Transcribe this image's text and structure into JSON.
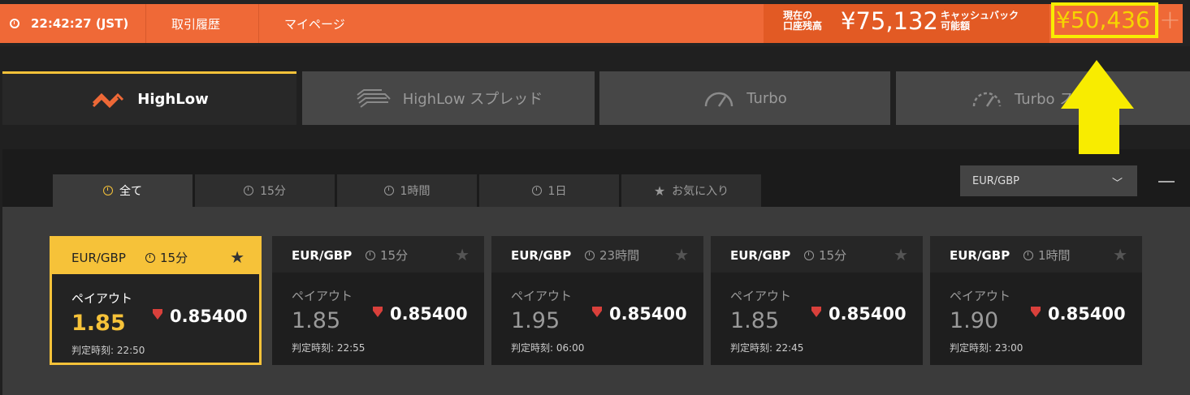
{
  "topbar": {
    "time": "22:42:27 (JST)",
    "nav": [
      "取引履歴",
      "マイページ"
    ],
    "balance_label_1": "現在の",
    "balance_label_2": "口座残高",
    "balance_value": "¥75,132",
    "cashback_label_1": "キャッシュバック",
    "cashback_label_2": "可能額",
    "cashback_value": "¥50,436",
    "plus_icon": "+"
  },
  "product_tabs": [
    {
      "label": "HighLow",
      "icon": "highlow-icon",
      "active": true
    },
    {
      "label": "HighLow スプレッド",
      "icon": "highlow-spread-icon",
      "active": false
    },
    {
      "label": "Turbo",
      "icon": "speedometer-icon",
      "active": false
    },
    {
      "label": "Turbo ス",
      "icon": "speedometer-icon",
      "active": false
    }
  ],
  "filter_tabs": [
    {
      "label": "全て",
      "icon": "clock-icon",
      "active": true
    },
    {
      "label": "15分",
      "icon": "clock-icon",
      "active": false
    },
    {
      "label": "1時間",
      "icon": "clock-icon",
      "active": false
    },
    {
      "label": "1日",
      "icon": "clock-icon",
      "active": false
    },
    {
      "label": "お気に入り",
      "icon": "star-icon",
      "active": false
    }
  ],
  "asset_select": {
    "value": "EUR/GBP",
    "chevron": "﹀"
  },
  "cards": [
    {
      "pair": "EUR/GBP",
      "duration": "15分",
      "payout_label": "ペイアウト",
      "payout": "1.85",
      "rate": "0.85400",
      "expiry": "判定時刻: 22:50",
      "active": true
    },
    {
      "pair": "EUR/GBP",
      "duration": "15分",
      "payout_label": "ペイアウト",
      "payout": "1.85",
      "rate": "0.85400",
      "expiry": "判定時刻: 22:55",
      "active": false
    },
    {
      "pair": "EUR/GBP",
      "duration": "23時間",
      "payout_label": "ペイアウト",
      "payout": "1.95",
      "rate": "0.85400",
      "expiry": "判定時刻: 06:00",
      "active": false
    },
    {
      "pair": "EUR/GBP",
      "duration": "15分",
      "payout_label": "ペイアウト",
      "payout": "1.85",
      "rate": "0.85400",
      "expiry": "判定時刻: 22:45",
      "active": false
    },
    {
      "pair": "EUR/GBP",
      "duration": "1時間",
      "payout_label": "ペイアウト",
      "payout": "1.90",
      "rate": "0.85400",
      "expiry": "判定時刻: 23:00",
      "active": false
    }
  ],
  "colors": {
    "accent_orange": "#ef6937",
    "accent_yellow": "#f6c239",
    "annotation": "#f8ec00",
    "down_red": "#d9403b"
  }
}
